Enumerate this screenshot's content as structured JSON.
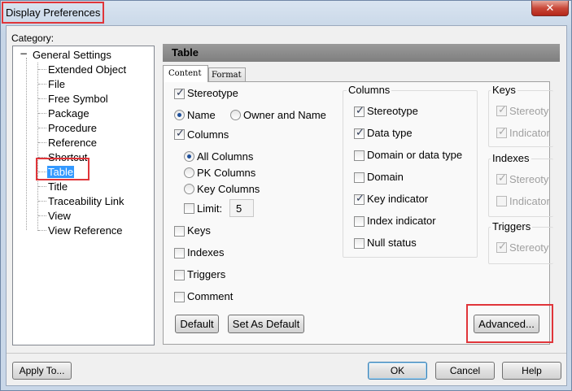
{
  "window": {
    "title": "Display Preferences",
    "close_glyph": "✕"
  },
  "category_label": "Category:",
  "tree": {
    "root": "General Settings",
    "children": [
      "Extended Object",
      "File",
      "Free Symbol",
      "Package",
      "Procedure",
      "Reference",
      "Shortcut",
      "Table",
      "Title",
      "Traceability Link",
      "View",
      "View Reference"
    ],
    "selected": "Table"
  },
  "panel": {
    "title": "Table"
  },
  "tabs": [
    "Content",
    "Format"
  ],
  "content": {
    "stereotype": "Stereotype",
    "name_option": "Name",
    "owner_name_option": "Owner and Name",
    "columns": "Columns",
    "all_columns": "All Columns",
    "pk_columns": "PK Columns",
    "key_columns": "Key Columns",
    "limit_label": "Limit:",
    "limit_value": "5",
    "keys": "Keys",
    "indexes": "Indexes",
    "triggers": "Triggers",
    "comment": "Comment"
  },
  "columns_group": {
    "title": "Columns",
    "items": [
      {
        "label": "Stereotype",
        "checked": true
      },
      {
        "label": "Data type",
        "checked": true
      },
      {
        "label": "Domain or data type",
        "checked": false
      },
      {
        "label": "Domain",
        "checked": false
      },
      {
        "label": "Key indicator",
        "checked": true
      },
      {
        "label": "Index indicator",
        "checked": false
      },
      {
        "label": "Null status",
        "checked": false
      }
    ]
  },
  "keys_group": {
    "title": "Keys",
    "items": [
      "Stereoty",
      "Indicator"
    ]
  },
  "indexes_group": {
    "title": "Indexes",
    "items": [
      "Stereoty",
      "Indicator"
    ]
  },
  "triggers_group": {
    "title": "Triggers",
    "items": [
      "Stereoty"
    ]
  },
  "buttons": {
    "default": "Default",
    "set_as_default": "Set As Default",
    "advanced": "Advanced...",
    "apply_to": "Apply To...",
    "ok": "OK",
    "cancel": "Cancel",
    "help": "Help"
  },
  "colors": {
    "highlight": "#e0353a",
    "selection": "#3399ff",
    "panel_header": "#8c8c8c"
  }
}
